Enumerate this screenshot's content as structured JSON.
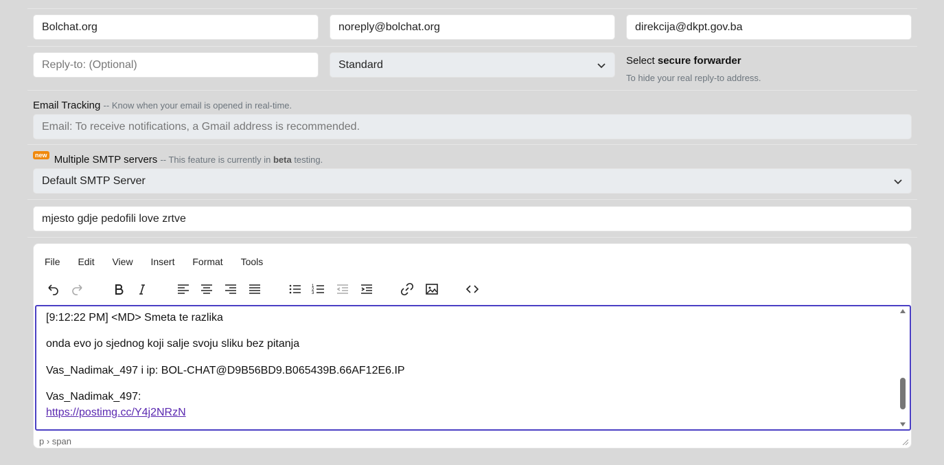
{
  "fields": {
    "from_name": "Bolchat.org",
    "from_email": "noreply@bolchat.org",
    "to_email": "direkcija@dkpt.gov.ba",
    "reply_to_placeholder": "Reply-to: (Optional)",
    "priority_selected": "Standard",
    "subject": "mjesto gdje pedofili love zrtve"
  },
  "secure_forwarder": {
    "prefix": "Select",
    "strong": "secure forwarder",
    "hint": "To hide your real reply-to address."
  },
  "tracking": {
    "label": "Email Tracking",
    "hint": "-- Know when your email is opened in real-time.",
    "placeholder": "Email: To receive notifications, a Gmail address is recommended."
  },
  "smtp": {
    "badge": "new",
    "label": "Multiple SMTP servers",
    "hint_pre": "-- This feature is currently in",
    "hint_bold": "beta",
    "hint_post": "testing.",
    "selected": "Default SMTP Server"
  },
  "editor": {
    "menu": [
      "File",
      "Edit",
      "View",
      "Insert",
      "Format",
      "Tools"
    ],
    "toolbar_icons": [
      "undo-icon",
      "redo-icon",
      "bold-icon",
      "italic-icon",
      "align-left-icon",
      "align-center-icon",
      "align-right-icon",
      "align-justify-icon",
      "bullet-list-icon",
      "numbered-list-icon",
      "outdent-icon",
      "indent-icon",
      "link-icon",
      "image-icon",
      "source-code-icon"
    ],
    "content": {
      "line1": "[9:12:22 PM] <MD> Smeta te razlika",
      "line2": "onda evo jo sjednog koji salje svoju sliku bez pitanja",
      "line3": "Vas_Nadimak_497 i ip: BOL-CHAT@D9B56BD9.B065439B.66AF12E6.IP",
      "line4": "Vas_Nadimak_497:",
      "link": "https://postimg.cc/Y4j2NRzN"
    },
    "status_path": "p › span"
  },
  "colors": {
    "background": "#d9d9d9",
    "editor_focus": "#4a3fc4",
    "badge": "#f0890d",
    "link": "#5a28b0"
  }
}
